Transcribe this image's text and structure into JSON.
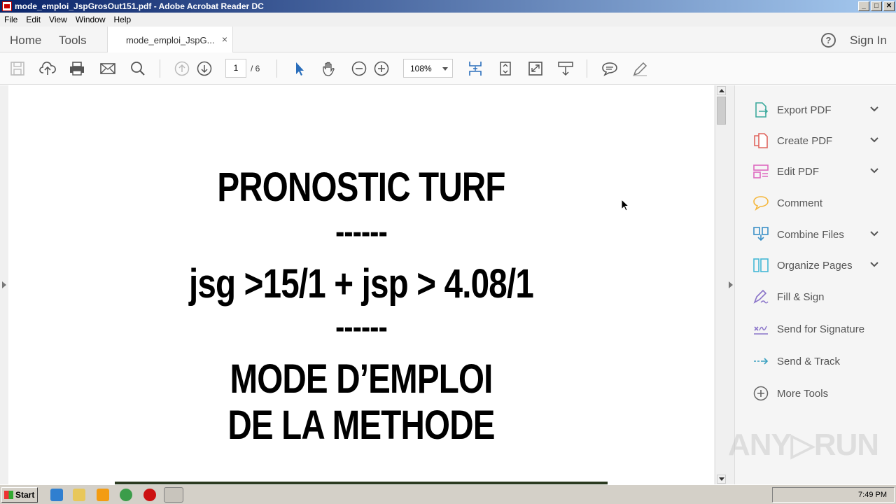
{
  "window": {
    "title": "mode_emploi_JspGrosOut151.pdf - Adobe Acrobat Reader DC",
    "controls": [
      "_",
      "□",
      "✕"
    ]
  },
  "menu": [
    "File",
    "Edit",
    "View",
    "Window",
    "Help"
  ],
  "nav": {
    "home": "Home",
    "tools": "Tools",
    "doc_tab": "mode_emploi_JspG...",
    "close": "×",
    "help": "?",
    "sign_in": "Sign In"
  },
  "toolbar": {
    "page_current": "1",
    "page_total": "/ 6",
    "zoom": "108%"
  },
  "document": {
    "lines": [
      "PRONOSTIC TURF",
      "------",
      "jsg >15/1 + jsp > 4.08/1",
      "------",
      "MODE D’EMPLOI",
      "DE LA METHODE"
    ]
  },
  "right_panel": {
    "items": [
      {
        "label": "Export PDF",
        "icon": "export-pdf-icon",
        "color": "#3daa9d",
        "has_chevron": true
      },
      {
        "label": "Create PDF",
        "icon": "create-pdf-icon",
        "color": "#e0665f",
        "has_chevron": true
      },
      {
        "label": "Edit PDF",
        "icon": "edit-pdf-icon",
        "color": "#de69c0",
        "has_chevron": true
      },
      {
        "label": "Comment",
        "icon": "comment-icon",
        "color": "#f5b73b",
        "has_chevron": false
      },
      {
        "label": "Combine Files",
        "icon": "combine-files-icon",
        "color": "#3a8fc7",
        "has_chevron": true
      },
      {
        "label": "Organize Pages",
        "icon": "organize-pages-icon",
        "color": "#45b8d6",
        "has_chevron": true
      },
      {
        "label": "Fill & Sign",
        "icon": "fill-sign-icon",
        "color": "#8a74c9",
        "has_chevron": false
      },
      {
        "label": "Send for Signature",
        "icon": "send-signature-icon",
        "color": "#8a74c9",
        "has_chevron": false
      },
      {
        "label": "Send & Track",
        "icon": "send-track-icon",
        "color": "#3aa0c0",
        "has_chevron": false
      },
      {
        "label": "More Tools",
        "icon": "more-tools-icon",
        "color": "#666666",
        "has_chevron": false
      }
    ]
  },
  "watermark": "ANY▷RUN",
  "taskbar": {
    "start": "Start",
    "time": "7:49 PM"
  }
}
